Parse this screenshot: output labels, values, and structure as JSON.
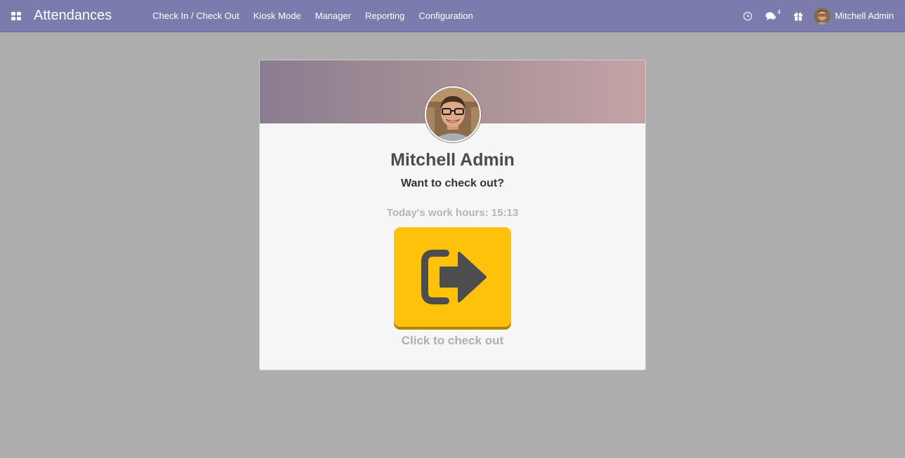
{
  "navbar": {
    "app_title": "Attendances",
    "menu": [
      {
        "label": "Check In / Check Out"
      },
      {
        "label": "Kiosk Mode"
      },
      {
        "label": "Manager"
      },
      {
        "label": "Reporting"
      },
      {
        "label": "Configuration"
      }
    ],
    "systray": {
      "activity_icon": "clock-icon",
      "messages_icon": "chat-icon",
      "messages_count": "4",
      "gift_icon": "gift-icon",
      "user_name": "Mitchell Admin"
    },
    "colors": {
      "bar": "#7c7bad"
    }
  },
  "card": {
    "employee_name": "Mitchell Admin",
    "question": "Want to check out?",
    "work_hours": "Today's work hours: 15:13",
    "button_icon": "sign-out-icon",
    "hint": "Click to check out",
    "colors": {
      "button": "#ffc20a",
      "header_from": "#8a7d90",
      "header_to": "#c4a3a6"
    }
  }
}
